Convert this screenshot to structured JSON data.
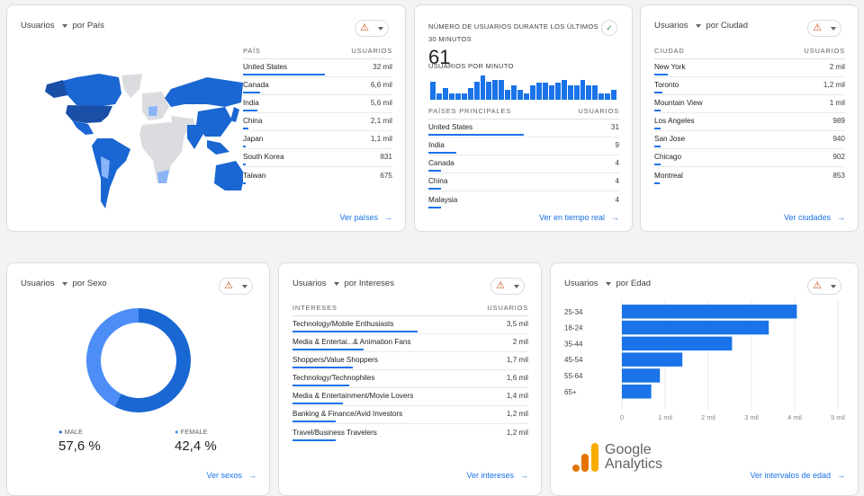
{
  "country_card": {
    "metric": "Usuarios",
    "dimension": "por País",
    "col1": "PAÍS",
    "col2": "USUARIOS",
    "rows": [
      {
        "label": "United States",
        "value": "32 mil",
        "n": 32000
      },
      {
        "label": "Canada",
        "value": "6,6 mil",
        "n": 6600
      },
      {
        "label": "India",
        "value": "5,6 mil",
        "n": 5600
      },
      {
        "label": "China",
        "value": "2,1 mil",
        "n": 2100
      },
      {
        "label": "Japan",
        "value": "1,1 mil",
        "n": 1100
      },
      {
        "label": "South Korea",
        "value": "831",
        "n": 831
      },
      {
        "label": "Taiwan",
        "value": "675",
        "n": 675
      }
    ],
    "link": "Ver países",
    "status_icon": "warning-icon"
  },
  "realtime_card": {
    "title_line1": "NÚMERO DE USUARIOS DURANTE LOS ÚLTIMOS",
    "title_line2": "30 MINUTOS",
    "count": "61",
    "subtitle": "USUARIOS POR MINUTO",
    "per_minute": [
      3,
      1,
      2,
      1,
      1,
      1,
      2,
      3,
      4,
      3,
      3.3,
      3.3,
      1.6,
      2.3,
      1.6,
      1,
      2.3,
      2.8,
      2.8,
      2.3,
      2.8,
      3.3,
      2.3,
      2.3,
      3.3,
      2.3,
      2.3,
      1,
      1,
      1.6
    ],
    "col1": "PAÍSES PRINCIPALES",
    "col2": "USUARIOS",
    "rows": [
      {
        "label": "United States",
        "value": "31",
        "n": 31
      },
      {
        "label": "India",
        "value": "9",
        "n": 9
      },
      {
        "label": "Canada",
        "value": "4",
        "n": 4
      },
      {
        "label": "China",
        "value": "4",
        "n": 4
      },
      {
        "label": "Malaysia",
        "value": "4",
        "n": 4
      }
    ],
    "link": "Ver en tiempo real",
    "status_icon": "check-circle-icon",
    "accent": "#1e8e3e"
  },
  "city_card": {
    "metric": "Usuarios",
    "dimension": "por Ciudad",
    "col1": "CIUDAD",
    "col2": "USUARIOS",
    "rows": [
      {
        "label": "New York",
        "value": "2 mil",
        "n": 2000
      },
      {
        "label": "Toronto",
        "value": "1,2 mil",
        "n": 1200
      },
      {
        "label": "Mountain View",
        "value": "1 mil",
        "n": 1000
      },
      {
        "label": "Los Angeles",
        "value": "989",
        "n": 989
      },
      {
        "label": "San Jose",
        "value": "940",
        "n": 940
      },
      {
        "label": "Chicago",
        "value": "902",
        "n": 902
      },
      {
        "label": "Montreal",
        "value": "853",
        "n": 853
      }
    ],
    "link": "Ver ciudades"
  },
  "gender_card": {
    "metric": "Usuarios",
    "dimension": "por Sexo",
    "segments": [
      {
        "label": "MALE",
        "value": "57,6 %",
        "pct": 57.6,
        "color": "#1967d2"
      },
      {
        "label": "FEMALE",
        "value": "42,4 %",
        "pct": 42.4,
        "color": "#4c8df6"
      }
    ],
    "link": "Ver sexos"
  },
  "interests_card": {
    "metric": "Usuarios",
    "dimension": "por Intereses",
    "col1": "INTERESES",
    "col2": "USUARIOS",
    "rows": [
      {
        "label": "Technology/Mobile Enthusiasts",
        "value": "3,5 mil",
        "n": 3500
      },
      {
        "label": "Media & Entertai...& Animation Fans",
        "value": "2 mil",
        "n": 2000
      },
      {
        "label": "Shoppers/Value Shoppers",
        "value": "1,7 mil",
        "n": 1700
      },
      {
        "label": "Technology/Technophiles",
        "value": "1,6 mil",
        "n": 1600
      },
      {
        "label": "Media & Entertainment/Movie Lovers",
        "value": "1,4 mil",
        "n": 1400
      },
      {
        "label": "Banking & Finance/Avid Investors",
        "value": "1,2 mil",
        "n": 1200
      },
      {
        "label": "Travel/Business Travelers",
        "value": "1,2 mil",
        "n": 1200
      }
    ],
    "link": "Ver intereses"
  },
  "age_card": {
    "metric": "Usuarios",
    "dimension": "por Edad",
    "link": "Ver intervalos de edad",
    "logo": {
      "line1": "Google",
      "line2": "Analytics"
    }
  },
  "chart_data": {
    "type": "bar",
    "orientation": "horizontal",
    "categories": [
      "25-34",
      "18-24",
      "35-44",
      "45-54",
      "55-64",
      "65+"
    ],
    "values": [
      4050,
      3400,
      2550,
      1400,
      880,
      680
    ],
    "xlim": [
      0,
      5000
    ],
    "xticks": [
      "0",
      "1 mil",
      "2 mil",
      "3 mil",
      "4 mil",
      "5 mil"
    ],
    "grid": true,
    "color": "#1a73e8"
  },
  "colors": {
    "accent": "#1a73e8",
    "dark_map": "#1a4fa8",
    "mid_map": "#1a66d2",
    "light_map": "#8ab4f8",
    "no_data": "#dadce0",
    "warning": "#c5521a"
  }
}
